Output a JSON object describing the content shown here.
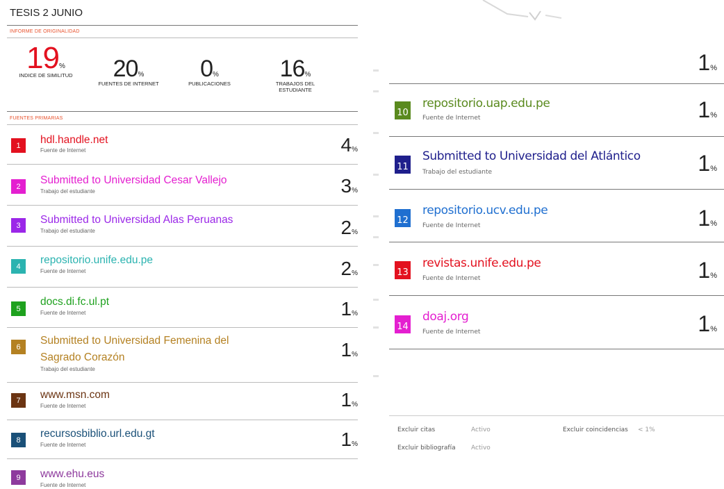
{
  "title": "TESIS 2 JUNIO",
  "report_label": "INFORME DE ORIGINALIDAD",
  "stats": [
    {
      "value": "19",
      "pct": "%",
      "caption": "INDICE DE SIMILITUD"
    },
    {
      "value": "20",
      "pct": "%",
      "caption": "FUENTES DE INTERNET"
    },
    {
      "value": "0",
      "pct": "%",
      "caption": "PUBLICACIONES"
    },
    {
      "value": "16",
      "pct": "%",
      "caption": "TRABAJOS DEL ESTUDIANTE"
    }
  ],
  "primary_label": "FUENTES PRIMARIAS",
  "sources": [
    {
      "num": "1",
      "name": "hdl.handle.net",
      "type": "Fuente de Internet",
      "pct": "4",
      "color": "#e3111f"
    },
    {
      "num": "2",
      "name": "Submitted to Universidad Cesar Vallejo",
      "type": "Trabajo del estudiante",
      "pct": "3",
      "color": "#e41fd0"
    },
    {
      "num": "3",
      "name": "Submitted to Universidad Alas Peruanas",
      "type": "Trabajo del estudiante",
      "pct": "2",
      "color": "#9b27e8"
    },
    {
      "num": "4",
      "name": "repositorio.unife.edu.pe",
      "type": "Fuente de Internet",
      "pct": "2",
      "color": "#2bb3b0"
    },
    {
      "num": "5",
      "name": "docs.di.fc.ul.pt",
      "type": "Fuente de Internet",
      "pct": "1",
      "color": "#1ea11e"
    },
    {
      "num": "6",
      "name": "Submitted to Universidad Femenina del Sagrado Corazón",
      "name_line1": "Submitted to Universidad Femenina del",
      "name_line2": "Sagrado Corazón",
      "type": "Trabajo del estudiante",
      "pct": "1",
      "color": "#b48122"
    },
    {
      "num": "7",
      "name": "www.msn.com",
      "type": "Fuente de Internet",
      "pct": "1",
      "color": "#6b3412"
    },
    {
      "num": "8",
      "name": "recursosbiblio.url.edu.gt",
      "type": "Fuente de Internet",
      "pct": "1",
      "color": "#1a5078"
    },
    {
      "num": "9",
      "name": "www.ehu.eus",
      "type": "Fuente de Internet",
      "pct": "",
      "color": "#8e3a9d"
    },
    {
      "num": "10",
      "name": "repositorio.uap.edu.pe",
      "type": "Fuente de Internet",
      "pct": "1",
      "color": "#5a8a1e"
    },
    {
      "num": "11",
      "name": "Submitted to Universidad del Atlántico",
      "type": "Trabajo del estudiante",
      "pct": "1",
      "color": "#1f1f8c"
    },
    {
      "num": "12",
      "name": "repositorio.ucv.edu.pe",
      "type": "Fuente de Internet",
      "pct": "1",
      "color": "#1f6fd0"
    },
    {
      "num": "13",
      "name": "revistas.unife.edu.pe",
      "type": "Fuente de Internet",
      "pct": "1",
      "color": "#e3111f"
    },
    {
      "num": "14",
      "name": "doaj.org",
      "type": "Fuente de Internet",
      "pct": "1",
      "color": "#e41fd0"
    }
  ],
  "right_top_pct": "1",
  "pct_symbol": "%",
  "exclusions": {
    "citas_label": "Excluir citas",
    "citas_value": "Activo",
    "bib_label": "Excluir bibliografía",
    "bib_value": "Activo",
    "coinc_label": "Excluir coincidencias",
    "coinc_value": "< 1%"
  }
}
